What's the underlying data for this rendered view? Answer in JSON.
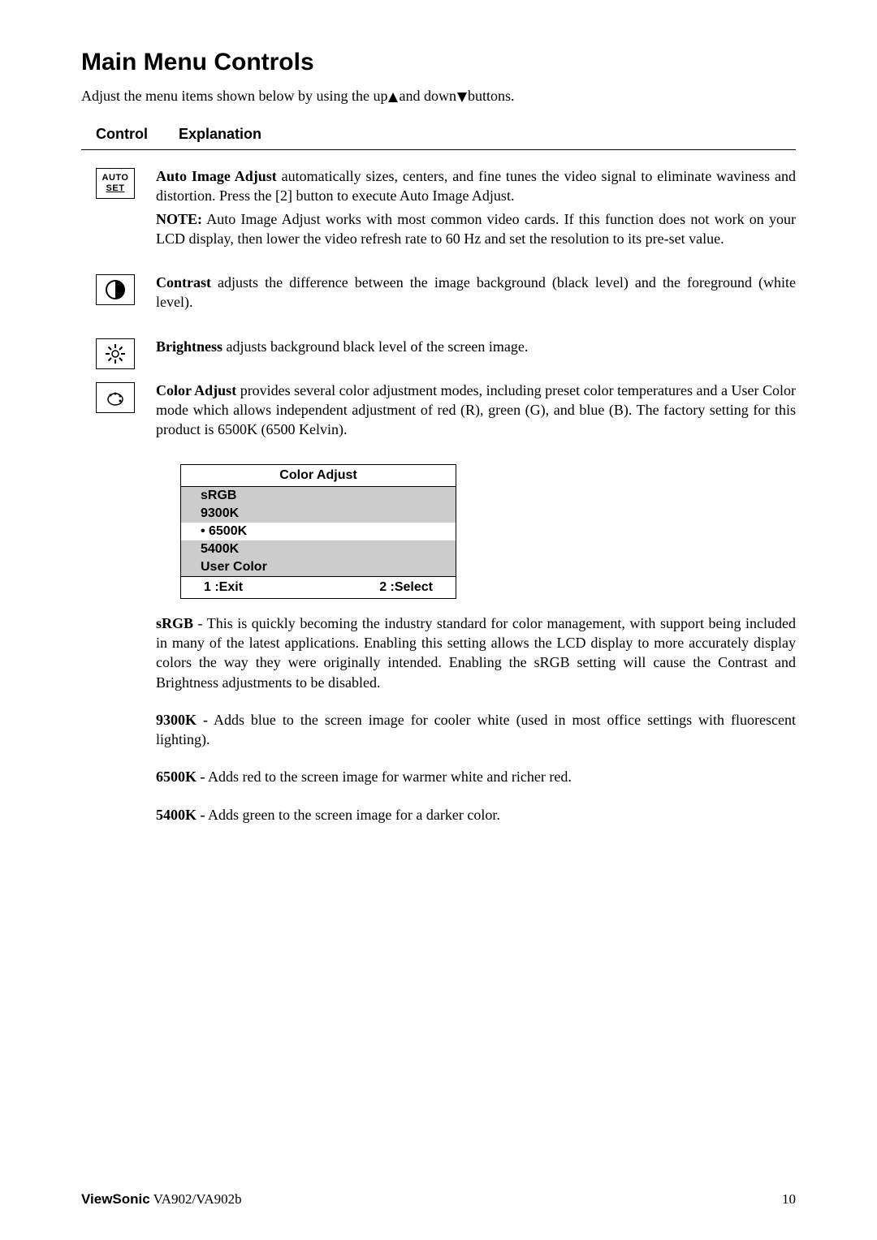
{
  "title": "Main Menu Controls",
  "intro_pre": "Adjust the menu items shown below by using the up",
  "intro_mid": "and down",
  "intro_post": "buttons.",
  "header": {
    "control": "Control",
    "explanation": "Explanation"
  },
  "autoset_icon": {
    "line1": "AUTO",
    "line2": "SET"
  },
  "auto": {
    "p1_bold": "Auto Image Adjust",
    "p1_rest": " automatically sizes, centers, and fine tunes the video signal to eliminate waviness and distortion. Press the [2] button to execute Auto Image Adjust.",
    "p2_bold": "NOTE:",
    "p2_rest": " Auto Image Adjust works with most common video cards. If this function does not work on your LCD display, then lower the video refresh rate to 60 Hz and set the resolution to its pre-set value."
  },
  "contrast": {
    "bold": "Contrast",
    "rest": " adjusts the difference between the image background  (black level) and the foreground (white level)."
  },
  "brightness": {
    "bold": "Brightness",
    "rest": " adjusts background black level of the screen image."
  },
  "coloradjust": {
    "bold": "Color Adjust",
    "rest": " provides several color adjustment modes, including preset color temperatures and a User Color mode which allows independent adjustment of red (R), green (G), and blue (B). The factory setting for this product is 6500K (6500 Kelvin)."
  },
  "osd": {
    "title": "Color Adjust",
    "rows": [
      "sRGB",
      "9300K",
      "6500K",
      "5400K",
      "User Color"
    ],
    "footer_left": "1 :Exit",
    "footer_right": "2 :Select"
  },
  "srgb": {
    "bold": "sRGB",
    "rest": " - This is quickly becoming the industry standard for color management, with support being included in many of the latest applications. Enabling this setting allows the LCD display to more accurately display colors the way they were originally intended. Enabling the sRGB setting will cause the Contrast and Brightness adjustments to be disabled."
  },
  "k9300": {
    "bold": "9300K -",
    "rest": " Adds blue to the screen image for cooler white (used in most office settings with fluorescent lighting)."
  },
  "k6500": {
    "bold": "6500K -",
    "rest": " Adds red to the screen image for warmer white and richer red."
  },
  "k5400": {
    "bold": "5400K -",
    "rest": " Adds green to the screen image for a darker color."
  },
  "footer": {
    "brand": "ViewSonic",
    "model": "  VA902/VA902b",
    "page": "10"
  }
}
